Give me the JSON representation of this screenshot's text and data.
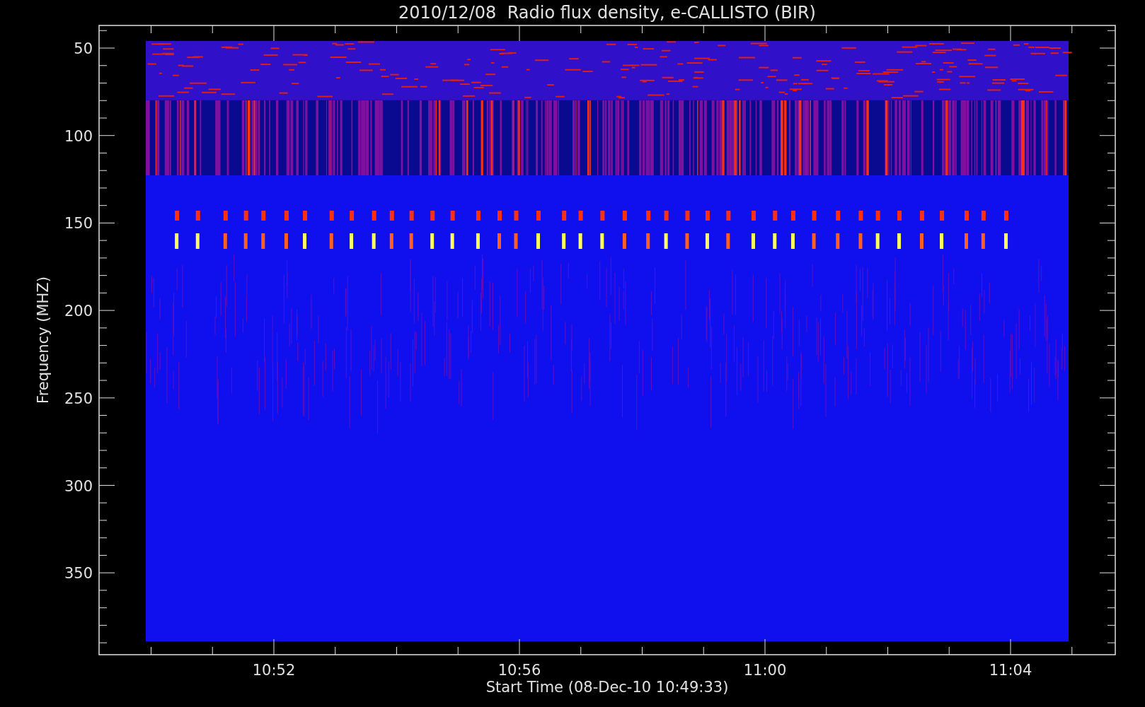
{
  "title": "2010/12/08  Radio flux density, e-CALLISTO (BIR)",
  "y_axis": {
    "label": "Frequency (MHZ)",
    "ticks": [
      "50",
      "100",
      "150",
      "200",
      "250",
      "300",
      "350"
    ]
  },
  "x_axis": {
    "label": "Start Time (08-Dec-10 10:49:33)",
    "ticks": [
      "10:52",
      "10:56",
      "11:00",
      "11:04"
    ]
  }
}
